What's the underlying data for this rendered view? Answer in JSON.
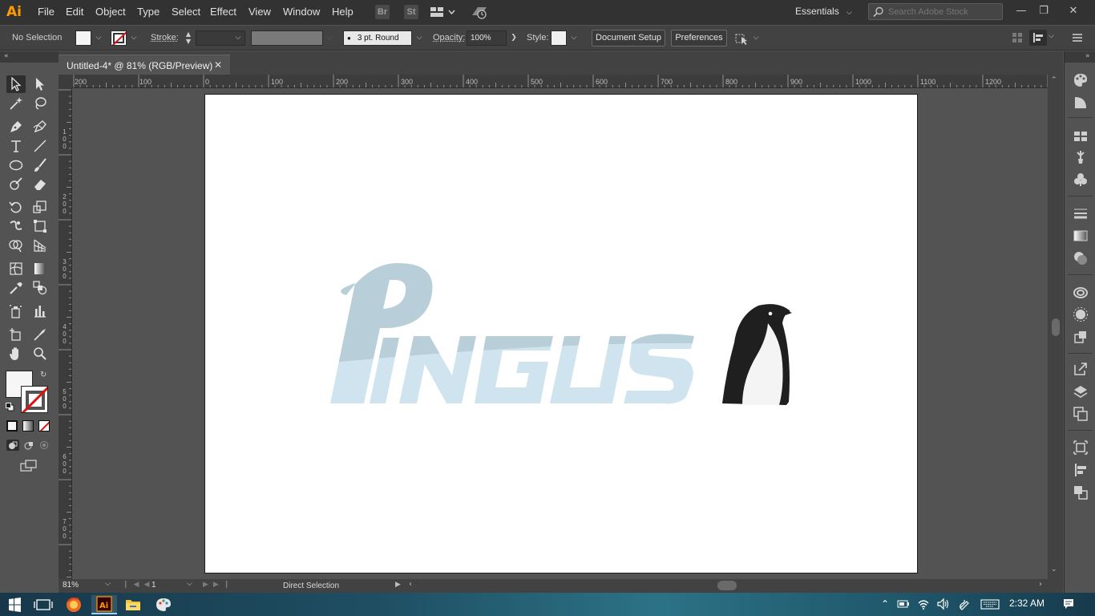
{
  "app": {
    "logo_text": "Ai",
    "menu": [
      "File",
      "Edit",
      "Object",
      "Type",
      "Select",
      "Effect",
      "View",
      "Window",
      "Help"
    ],
    "bridge_label": "Br",
    "stock_label": "St",
    "workspace": "Essentials",
    "search_placeholder": "Search Adobe Stock"
  },
  "control_bar": {
    "selection_state": "No Selection",
    "stroke_label": "Stroke:",
    "brush_label": "3 pt. Round",
    "opacity_label": "Opacity:",
    "opacity_value": "100%",
    "style_label": "Style:",
    "document_setup_label": "Document Setup",
    "preferences_label": "Preferences"
  },
  "document": {
    "tab_title": "Untitled-4* @ 81% (RGB/Preview)",
    "tab_close": "✕"
  },
  "rulers": {
    "horizontal": [
      "200",
      "100",
      "0",
      "100",
      "200",
      "300",
      "400",
      "500",
      "600",
      "700",
      "800",
      "900",
      "1000",
      "1100",
      "1200"
    ],
    "vertical": [
      "1 0 0",
      "2 0 0",
      "3 0 0",
      "4 0 0",
      "5 0 0",
      "6 0 0",
      "7 0 0"
    ]
  },
  "artwork": {
    "logo_text": "PINGUS",
    "colors": {
      "logo_upper": "#b8cfda",
      "logo_lower": "#cfe4ef",
      "penguin_body": "#1f1f1f",
      "penguin_belly": "#f4f4f4"
    }
  },
  "status_bar": {
    "zoom": "81%",
    "artboard_number": "1",
    "active_tool": "Direct Selection"
  },
  "taskbar": {
    "clock": "2:32 AM"
  },
  "theme": {
    "app_background": "#535353",
    "menubar": "#323232",
    "panel": "#424242",
    "accent": "#ff9a00"
  }
}
